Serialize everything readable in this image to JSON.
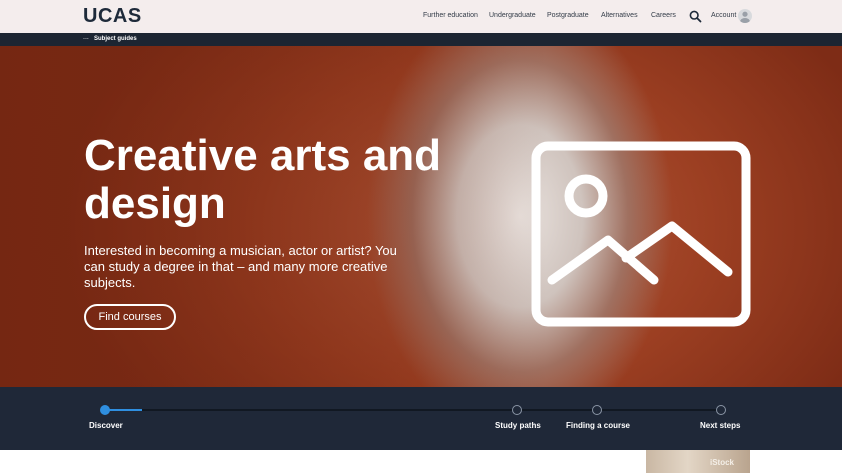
{
  "header": {
    "logo": "UCAS",
    "nav": [
      "Further education",
      "Undergraduate",
      "Postgraduate",
      "Alternatives",
      "Careers"
    ],
    "account_label": "Account"
  },
  "subbar": {
    "ellipsis": "...",
    "link": "Subject guides"
  },
  "hero": {
    "title": "Creative arts and design",
    "description": "Interested in becoming a musician, actor or artist? You can study a degree in that – and many more creative subjects.",
    "button_label": "Find courses",
    "image_icon": "image-placeholder-icon"
  },
  "progress": {
    "steps": [
      "Discover",
      "Study paths",
      "Finding a course",
      "Next steps"
    ],
    "active_step": "Discover",
    "fill_fraction": 0.06
  },
  "bottom": {
    "thumbnail_text": "iStock"
  },
  "colors": {
    "header_bg": "#f4eded",
    "nav_dark": "#1c2532",
    "hero_rust": "#9c3f22",
    "progress_bg": "#1f2838",
    "accent_blue": "#2f8fe0"
  }
}
